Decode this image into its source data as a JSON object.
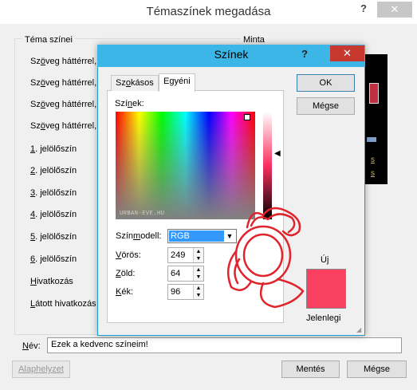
{
  "outer_dialog": {
    "title": "Témaszínek megadása",
    "help_glyph": "?",
    "close_glyph": "✕",
    "group_label": "Téma színei",
    "rows": [
      {
        "prefix": "Sz",
        "accel": "ö",
        "rest": "veg háttérrel,"
      },
      {
        "prefix": "Sz",
        "accel": "ö",
        "rest": "veg háttérrel,"
      },
      {
        "prefix": "Sz",
        "accel": "ö",
        "rest": "veg háttérrel,"
      },
      {
        "prefix": "Sz",
        "accel": "ö",
        "rest": "veg háttérrel,"
      },
      {
        "prefix": "",
        "accel": "1",
        "rest": ". jelölőszín"
      },
      {
        "prefix": "",
        "accel": "2",
        "rest": ". jelölőszín"
      },
      {
        "prefix": "",
        "accel": "3",
        "rest": ". jelölőszín"
      },
      {
        "prefix": "",
        "accel": "4",
        "rest": ". jelölőszín"
      },
      {
        "prefix": "",
        "accel": "5",
        "rest": ". jelölőszín"
      },
      {
        "prefix": "",
        "accel": "6",
        "rest": ". jelölőszín"
      },
      {
        "prefix": "",
        "accel": "H",
        "rest": "ivatkozás"
      },
      {
        "prefix": "",
        "accel": "L",
        "rest": "átott hivatkozás"
      }
    ],
    "sample_label": "Minta",
    "sample_link1": "s",
    "sample_link2": "s",
    "name_label_accel": "N",
    "name_label_rest": "év:",
    "name_value": "Ezek a kedvenc színeim!",
    "reset_label": "Alaphelyzet",
    "save_label": "Mentés",
    "cancel_label": "Mégse"
  },
  "colors_dialog": {
    "title": "Színek",
    "help_glyph": "?",
    "min_glyph": "—",
    "close_glyph": "✕",
    "tabs": [
      {
        "label": "Szokásos",
        "accel": "o",
        "before": "Sz",
        "after": "kásos"
      },
      {
        "label": "Egyéni",
        "accel": "",
        "before": "Egyéni",
        "after": ""
      }
    ],
    "colors_label_before": "Szí",
    "colors_label_accel": "n",
    "colors_label_after": "ek:",
    "watermark": "URBAN-EVE.HU",
    "model_label_before": "Szín",
    "model_label_accel": "m",
    "model_label_after": "odell:",
    "model_value": "RGB",
    "red_label_accel": "V",
    "red_label_rest": "örös:",
    "red_value": "249",
    "green_label_accel": "Z",
    "green_label_rest": "öld:",
    "green_value": "64",
    "blue_label_accel": "K",
    "blue_label_rest": "ék:",
    "blue_value": "96",
    "ok_label": "OK",
    "cancel_label": "Mégse",
    "new_label": "Új",
    "current_label": "Jelenlegi",
    "new_color": "#f94060"
  },
  "annotation": {
    "color": "#e0242c",
    "shape": "hand-drawn-circle-with-arrows"
  }
}
